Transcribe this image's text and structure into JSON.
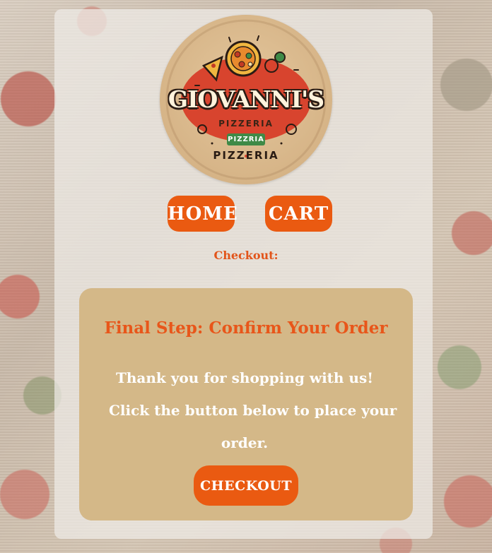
{
  "logo": {
    "title": "GIOVANNI'S",
    "subtitle_top": "PIZZERIA",
    "ribbon": "PIZZRIA",
    "subtitle_bottom": "PIZZERIA",
    "icon": "pizza-logo-icon"
  },
  "nav": {
    "home_label": "HOME",
    "cart_label": "CART"
  },
  "page": {
    "section_label": "Checkout:"
  },
  "card": {
    "title": "Final Step: Confirm Your Order",
    "message_line1": "Thank you for shopping with us!",
    "message_line2": "Click the button below to place your",
    "message_line3": "order.",
    "button_label": "CHECKOUT"
  },
  "colors": {
    "accent": "#ea5a11",
    "card_bg": "#d4b888",
    "title_orange": "#e8561a"
  }
}
